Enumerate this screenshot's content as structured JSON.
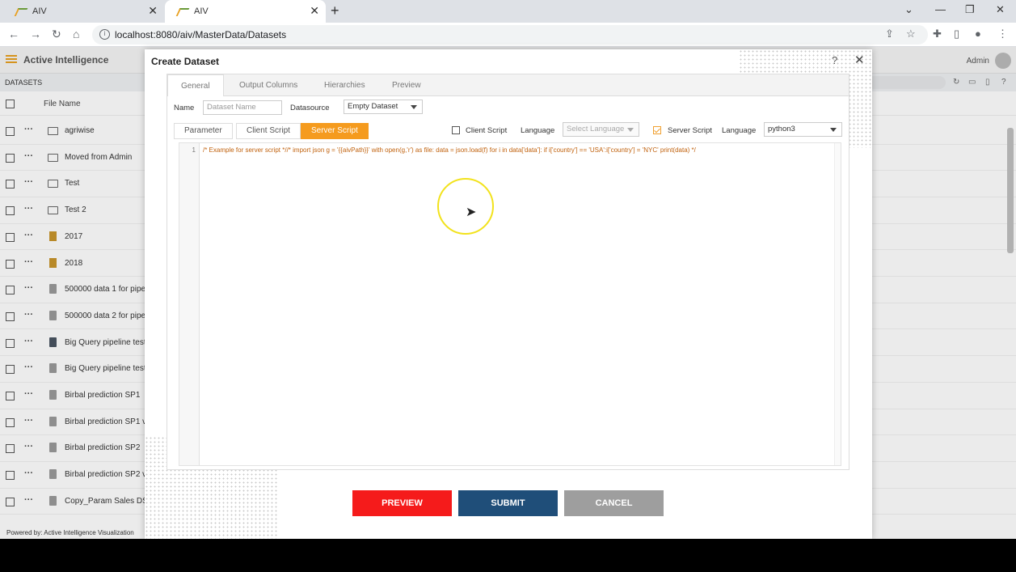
{
  "browser": {
    "tabs": [
      {
        "title": "AIV"
      },
      {
        "title": "AIV"
      }
    ],
    "tab_close": "✕",
    "new_tab": "+",
    "url": "localhost:8080/aiv/MasterData/Datasets",
    "window_controls": {
      "dropdown": "⌄",
      "minimize": "—",
      "restore": "❐",
      "close": "✕"
    }
  },
  "app": {
    "title": "Active Intelligence",
    "user": "Admin",
    "section": "DATASETS",
    "list_header": "File Name",
    "rows": [
      {
        "name": "agriwise",
        "icon": "folder"
      },
      {
        "name": "Moved from Admin",
        "icon": "folder"
      },
      {
        "name": "Test",
        "icon": "folder"
      },
      {
        "name": "Test 2",
        "icon": "folder"
      },
      {
        "name": "2017",
        "icon": "cube"
      },
      {
        "name": "2018",
        "icon": "cube"
      },
      {
        "name": "500000 data 1 for pipe",
        "icon": "db"
      },
      {
        "name": "500000 data 2 for pipe",
        "icon": "db"
      },
      {
        "name": "Big Query pipeline test",
        "icon": "dbdark"
      },
      {
        "name": "Big Query pipeline test",
        "icon": "db"
      },
      {
        "name": "Birbal prediction SP1",
        "icon": "db"
      },
      {
        "name": "Birbal prediction SP1 v",
        "icon": "db"
      },
      {
        "name": "Birbal prediction SP2",
        "icon": "db"
      },
      {
        "name": "Birbal prediction SP2 v",
        "icon": "db"
      },
      {
        "name": "Copy_Param Sales DS",
        "icon": "db"
      }
    ],
    "powered_by": "Powered by: Active Intelligence Visualization"
  },
  "modal": {
    "title": "Create Dataset",
    "help": "?",
    "close": "✕",
    "tabs": [
      "General",
      "Output Columns",
      "Hierarchies",
      "Preview"
    ],
    "active_tab": "General",
    "name_label": "Name",
    "name_placeholder": "Dataset Name",
    "datasource_label": "Datasource",
    "datasource_value": "Empty Dataset",
    "subtabs": [
      "Parameter",
      "Client Script",
      "Server Script"
    ],
    "active_subtab": "Server Script",
    "client_script_label": "Client Script",
    "client_script_checked": false,
    "client_language_label": "Language",
    "client_language_value": "Select Language",
    "server_script_label": "Server Script",
    "server_script_checked": true,
    "server_language_label": "Language",
    "server_language_value": "python3",
    "line_number": "1",
    "code": "/* Example for server script *//* import json g = '{{aivPath}}' with open(g,'r') as file: data = json.load(f) for i in data['data']: if i['country'] == 'USA':i['country'] = 'NYC' print(data) */",
    "buttons": {
      "preview": "PREVIEW",
      "submit": "SUBMIT",
      "cancel": "CANCEL"
    }
  },
  "colors": {
    "accent": "#f59b1e",
    "preview_button": "#f51b1b",
    "submit_button": "#1f4e79",
    "cancel_button": "#9e9e9e",
    "code_text": "#c1620e",
    "cursor_highlight": "#f2e21b"
  }
}
